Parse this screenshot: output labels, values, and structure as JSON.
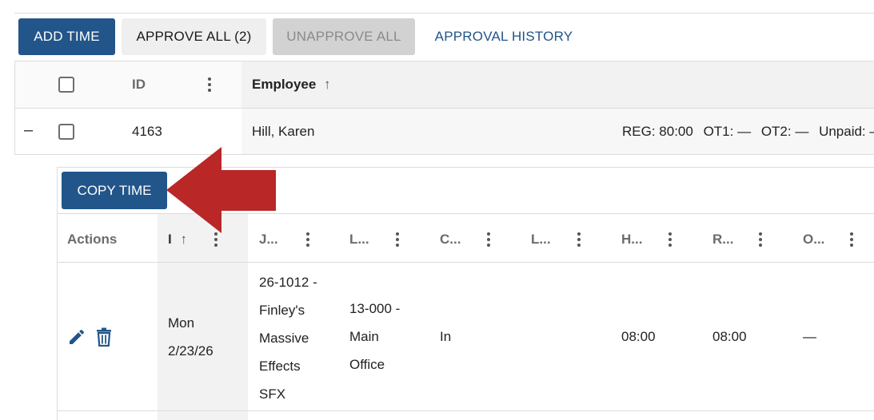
{
  "toolbar": {
    "add_time": "ADD TIME",
    "approve_all": "APPROVE ALL (2)",
    "unapprove_all": "UNAPPROVE ALL",
    "approval_history": "APPROVAL HISTORY"
  },
  "grid": {
    "col_id": "ID",
    "col_employee": "Employee",
    "sort_icon": "arrow-up-icon",
    "row": {
      "collapse_symbol": "–",
      "id": "4163",
      "employee": "Hill, Karen",
      "reg": "REG: 80:00",
      "ot1": "OT1: —",
      "ot2": "OT2: —",
      "unpaid": "Unpaid: —"
    }
  },
  "detail": {
    "copy_time": "COPY TIME",
    "headers": {
      "actions": "Actions",
      "date": "I",
      "job": "J...",
      "location": "L...",
      "clock": "C...",
      "l2": "L...",
      "hours": "H...",
      "reg": "R...",
      "ot": "O..."
    },
    "row": {
      "date_line1": "Mon",
      "date_line2": "2/23/26",
      "job_lines": [
        "26-1012 -",
        "Finley's",
        "Massive",
        "Effects",
        "SFX"
      ],
      "location_lines": [
        "13-000 -",
        "Main",
        "Office"
      ],
      "clock": "In",
      "hours": "08:00",
      "reg": "08:00",
      "ot": "—"
    }
  },
  "annotation": {
    "arrow_color": "#b92727"
  },
  "colors": {
    "primary": "#22558a",
    "header_bg": "#f2f2f2"
  }
}
